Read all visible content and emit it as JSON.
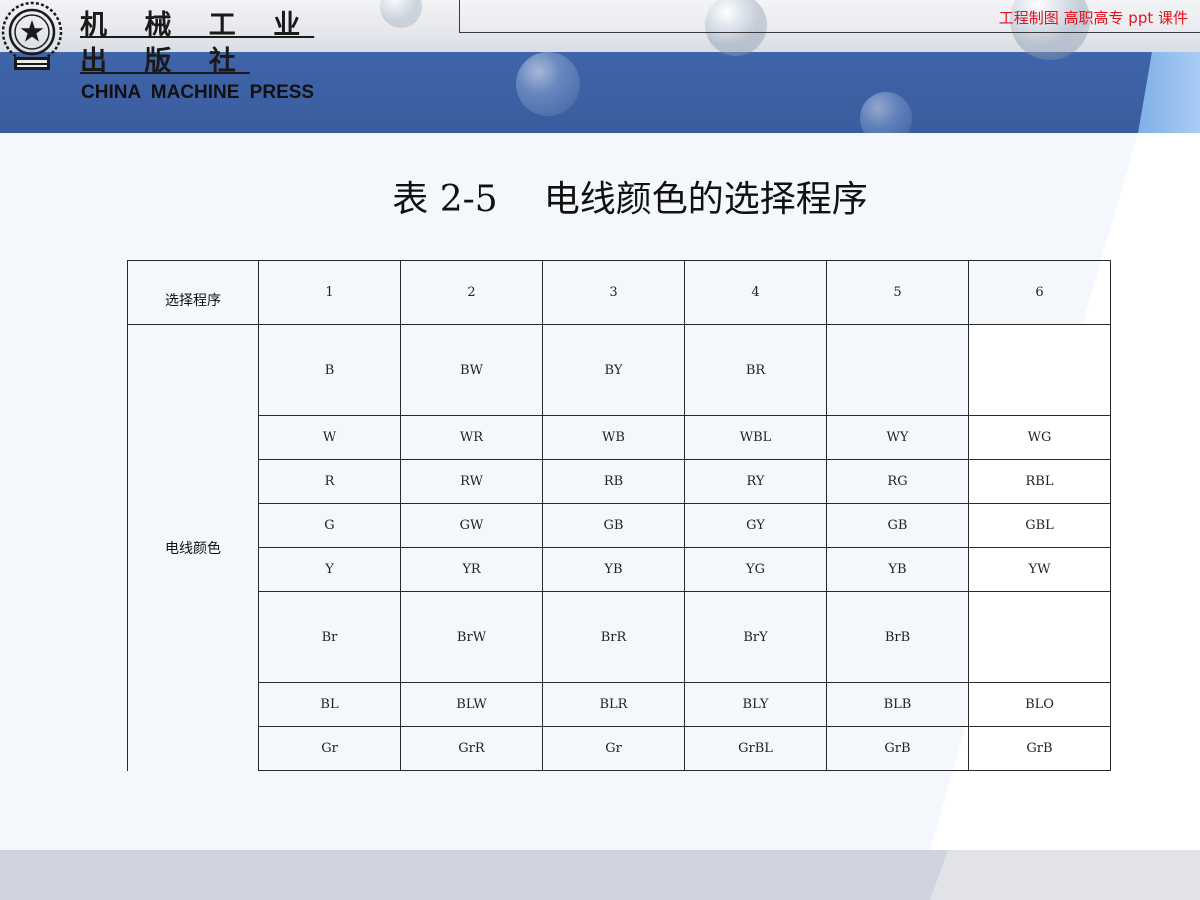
{
  "header": {
    "publisher_cn": "机 械 工 业 出 版 社",
    "publisher_en": "CHINA  MACHINE PRESS",
    "course_tag": "工程制图  高职高专   ppt  课件"
  },
  "title": {
    "number": "表 2-5",
    "text": "电线颜色的选择程序"
  },
  "table": {
    "header_label": "选择程序",
    "columns": [
      "1",
      "2",
      "3",
      "4",
      "5",
      "6"
    ],
    "group_label": "电线颜色",
    "rows": [
      [
        "B",
        "BW",
        "BY",
        "BR",
        "",
        ""
      ],
      [
        "W",
        "WR",
        "WB",
        "WBL",
        "WY",
        "WG"
      ],
      [
        "R",
        "RW",
        "RB",
        "RY",
        "RG",
        "RBL"
      ],
      [
        "G",
        "GW",
        "GB",
        "GY",
        "GB",
        "GBL"
      ],
      [
        "Y",
        "YR",
        "YB",
        "YG",
        "YB",
        "YW"
      ],
      [
        "Br",
        "BrW",
        "BrR",
        "BrY",
        "BrB",
        ""
      ],
      [
        "BL",
        "BLW",
        "BLR",
        "BLY",
        "BLB",
        "BLO"
      ],
      [
        "Gr",
        "GrR",
        "Gr",
        "GrBL",
        "GrB",
        "GrB"
      ]
    ]
  },
  "colors": {
    "header_blue": "#3f63a8",
    "course_tag_red": "#e0141e"
  }
}
